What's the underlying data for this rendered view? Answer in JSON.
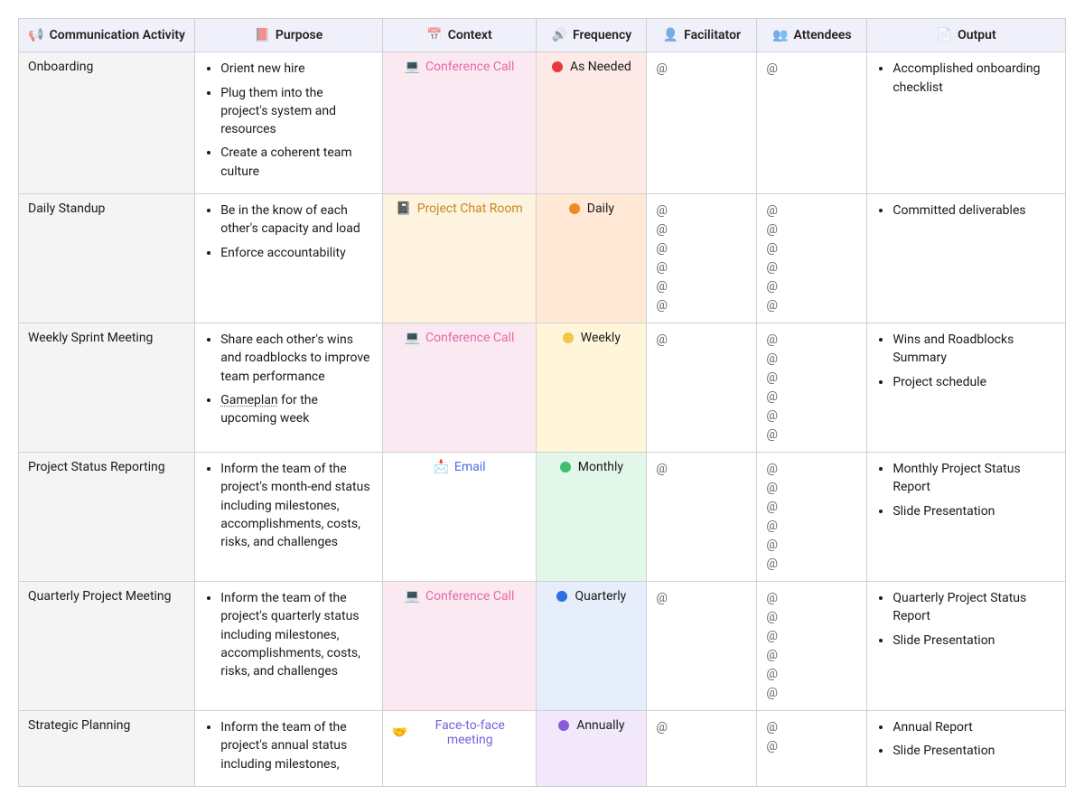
{
  "headers": {
    "activity": "Communication Activity",
    "purpose": "Purpose",
    "context": "Context",
    "frequency": "Frequency",
    "facilitator": "Facilitator",
    "attendees": "Attendees",
    "output": "Output"
  },
  "icons": {
    "activity": "📢",
    "purpose": "📕",
    "context": "📅",
    "frequency": "🔊",
    "facilitator": "👤",
    "attendees": "👥",
    "output": "📄"
  },
  "context_types": {
    "conference": {
      "label": "Conference Call",
      "icon": "💻",
      "css": "ctx-conf",
      "bg": "bg-conf"
    },
    "chat": {
      "label": "Project Chat Room",
      "icon": "📓",
      "css": "ctx-chat",
      "bg": "bg-chat"
    },
    "email": {
      "label": "Email",
      "icon": "📩",
      "css": "ctx-email",
      "bg": "bg-email"
    },
    "face": {
      "label": "Face-to-face meeting",
      "icon": "🤝",
      "css": "ctx-face",
      "bg": "bg-face"
    }
  },
  "frequency_types": {
    "asneeded": {
      "label": "As Needed",
      "dot": "d-red",
      "bg": "bgf-red"
    },
    "daily": {
      "label": "Daily",
      "dot": "d-orange",
      "bg": "bgf-orange"
    },
    "weekly": {
      "label": "Weekly",
      "dot": "d-yellow",
      "bg": "bgf-yellow"
    },
    "monthly": {
      "label": "Monthly",
      "dot": "d-green",
      "bg": "bgf-green"
    },
    "quarterly": {
      "label": "Quarterly",
      "dot": "d-blue",
      "bg": "bgf-blue"
    },
    "annually": {
      "label": "Annually",
      "dot": "d-purple",
      "bg": "bgf-purple"
    }
  },
  "rows": [
    {
      "activity": "Onboarding",
      "purpose": [
        "Orient new hire",
        "Plug them into the project's system and resources",
        "Create a coherent team culture"
      ],
      "context": "conference",
      "frequency": "asneeded",
      "facilitator_count": 1,
      "attendees_count": 1,
      "output": [
        "Accomplished onboarding checklist"
      ]
    },
    {
      "activity": "Daily Standup",
      "purpose": [
        "Be in the know of each other's capacity and load",
        "Enforce accountability"
      ],
      "context": "chat",
      "frequency": "daily",
      "facilitator_count": 6,
      "attendees_count": 6,
      "output": [
        "Committed deliverables"
      ]
    },
    {
      "activity": "Weekly Sprint Meeting",
      "purpose": [
        "Share each other's wins and roadblocks to improve team performance",
        "<u>Gameplan</u> for the upcoming week"
      ],
      "context": "conference",
      "frequency": "weekly",
      "facilitator_count": 1,
      "attendees_count": 6,
      "output": [
        "Wins and Roadblocks Summary",
        "Project schedule"
      ]
    },
    {
      "activity": "Project Status Reporting",
      "purpose": [
        "Inform the team of the project's month-end status including milestones, accomplishments, costs, risks, and challenges"
      ],
      "context": "email",
      "frequency": "monthly",
      "facilitator_count": 1,
      "attendees_count": 6,
      "output": [
        "Monthly Project Status Report",
        "Slide Presentation"
      ]
    },
    {
      "activity": "Quarterly Project Meeting",
      "purpose": [
        "Inform the team of the project's quarterly status including milestones, accomplishments, costs, risks, and challenges"
      ],
      "context": "conference",
      "frequency": "quarterly",
      "facilitator_count": 1,
      "attendees_count": 6,
      "output": [
        "Quarterly Project Status Report",
        "Slide Presentation"
      ]
    },
    {
      "activity": "Strategic Planning",
      "purpose": [
        "Inform the team of the project's annual status including milestones,"
      ],
      "context": "face",
      "frequency": "annually",
      "facilitator_count": 1,
      "attendees_count": 2,
      "output": [
        "Annual Report",
        "Slide Presentation"
      ]
    }
  ]
}
